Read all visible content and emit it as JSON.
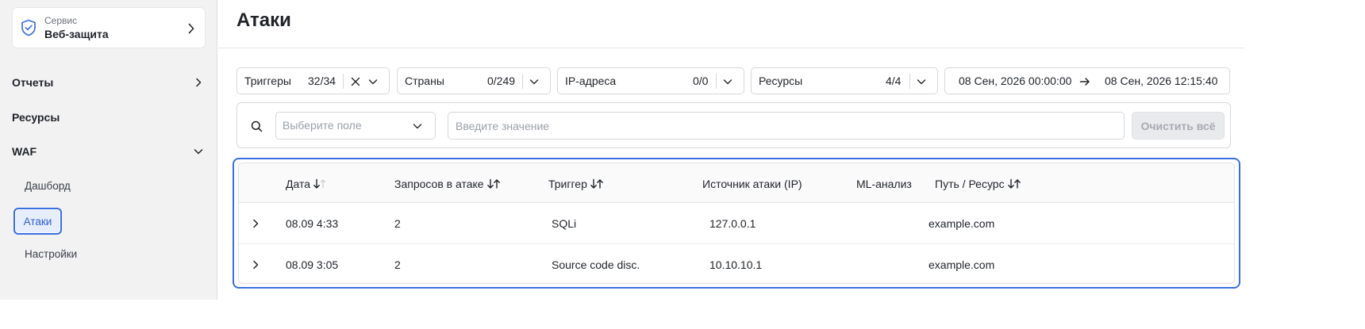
{
  "sidebar": {
    "service_label": "Сервис",
    "service_name": "Веб-защита",
    "nav": {
      "reports": "Отчеты",
      "resources": "Ресурсы",
      "waf": "WAF"
    },
    "sub": {
      "dashboard": "Дашборд",
      "attacks": "Атаки",
      "settings": "Настройки"
    }
  },
  "page": {
    "title": "Атаки"
  },
  "filters": {
    "triggers": {
      "label": "Триггеры",
      "count": "32/34"
    },
    "countries": {
      "label": "Страны",
      "count": "0/249"
    },
    "ips": {
      "label": "IP-адреса",
      "count": "0/0"
    },
    "resources": {
      "label": "Ресурсы",
      "count": "4/4"
    },
    "date_from": "08 Сен, 2026 00:00:00",
    "date_to": "08 Сен, 2026 12:15:40"
  },
  "search": {
    "field_placeholder": "Выберите поле",
    "value_placeholder": "Введите значение",
    "clear_label": "Очистить всё"
  },
  "table": {
    "headers": {
      "date": "Дата",
      "requests": "Запросов в атаке",
      "trigger": "Триггер",
      "source": "Источник атаки (IP)",
      "ml": "ML-анализ",
      "path": "Путь / Ресурс"
    },
    "rows": [
      {
        "date": "08.09 4:33",
        "requests": "2",
        "trigger": "SQLi",
        "source": "127.0.0.1",
        "path": "example.com"
      },
      {
        "date": "08.09 3:05",
        "requests": "2",
        "trigger": "Source code disc.",
        "source": "10.10.10.1",
        "path": "example.com"
      }
    ]
  },
  "colors": {
    "accent": "#3b6fe0",
    "sidebar_bg": "#f2f2f3",
    "active_bg": "#e6edfd"
  }
}
